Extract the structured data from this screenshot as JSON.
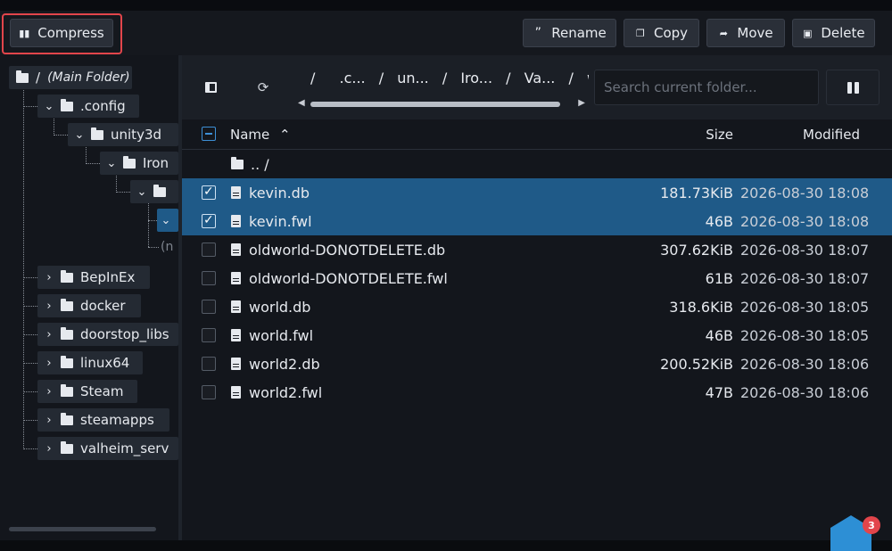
{
  "toolbar": {
    "compress_label": "Compress",
    "rename_label": "Rename",
    "copy_label": "Copy",
    "move_label": "Move",
    "delete_label": "Delete"
  },
  "tree": {
    "root_slash": "/",
    "root_label": "(Main Folder)",
    "config": ".config",
    "unity3d": "unity3d",
    "iron": "Iron",
    "placeholder_text": "(n",
    "folders": [
      "BepInEx",
      "docker",
      "doorstop_libs",
      "linux64",
      "Steam",
      "steamapps",
      "valheim_serv"
    ]
  },
  "path": {
    "crumbs": [
      "/",
      ".c...",
      "un...",
      "Iro...",
      "Va...",
      "worlds_l"
    ],
    "search_placeholder": "Search current folder..."
  },
  "table": {
    "col_name": "Name",
    "col_size": "Size",
    "col_modified": "Modified",
    "parent_label": ".. /",
    "rows": [
      {
        "name": "kevin.db",
        "size": "181.73KiB",
        "modified": "2026-08-30 18:08",
        "selected": true
      },
      {
        "name": "kevin.fwl",
        "size": "46B",
        "modified": "2026-08-30 18:08",
        "selected": true
      },
      {
        "name": "oldworld-DONOTDELETE.db",
        "size": "307.62KiB",
        "modified": "2026-08-30 18:07",
        "selected": false
      },
      {
        "name": "oldworld-DONOTDELETE.fwl",
        "size": "61B",
        "modified": "2026-08-30 18:07",
        "selected": false
      },
      {
        "name": "world.db",
        "size": "318.6KiB",
        "modified": "2026-08-30 18:05",
        "selected": false
      },
      {
        "name": "world.fwl",
        "size": "46B",
        "modified": "2026-08-30 18:05",
        "selected": false
      },
      {
        "name": "world2.db",
        "size": "200.52KiB",
        "modified": "2026-08-30 18:06",
        "selected": false
      },
      {
        "name": "world2.fwl",
        "size": "47B",
        "modified": "2026-08-30 18:06",
        "selected": false
      }
    ]
  },
  "chat": {
    "badge_count": "3"
  },
  "colors": {
    "selected_row": "#1f5a88",
    "highlight_border": "#e2454b",
    "accent": "#3d8fd6"
  }
}
